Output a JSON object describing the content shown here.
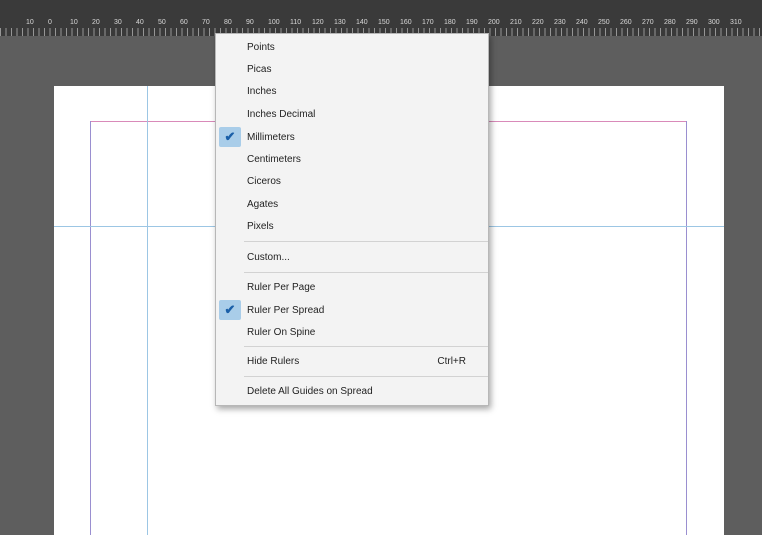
{
  "ruler": {
    "numbers": [
      "10",
      "0",
      "10",
      "20",
      "30",
      "40",
      "50",
      "60",
      "70",
      "80",
      "90",
      "100",
      "110",
      "120",
      "130",
      "140",
      "150",
      "160",
      "170",
      "180",
      "190",
      "200",
      "210",
      "220",
      "230",
      "240",
      "250",
      "260",
      "270",
      "280",
      "290",
      "300",
      "310"
    ]
  },
  "menu": {
    "units": [
      "Points",
      "Picas",
      "Inches",
      "Inches Decimal",
      "Millimeters",
      "Centimeters",
      "Ciceros",
      "Agates",
      "Pixels"
    ],
    "custom": "Custom...",
    "ruler_modes": [
      "Ruler Per Page",
      "Ruler Per Spread",
      "Ruler On Spine"
    ],
    "hide_rulers": "Hide Rulers",
    "hide_rulers_shortcut": "Ctrl+R",
    "delete_guides": "Delete All Guides on Spread",
    "checked_unit": "Millimeters",
    "checked_ruler_mode": "Ruler Per Spread",
    "check_icon": "checkmark-icon"
  },
  "colors": {
    "ruler_bg": "#3a3a3a",
    "pasteboard": "#5e5e5e",
    "page": "#ffffff",
    "margin_guide": "#d98ab9",
    "ruler_guide": "#9cc6e4",
    "check_highlight": "#a9cde9"
  }
}
